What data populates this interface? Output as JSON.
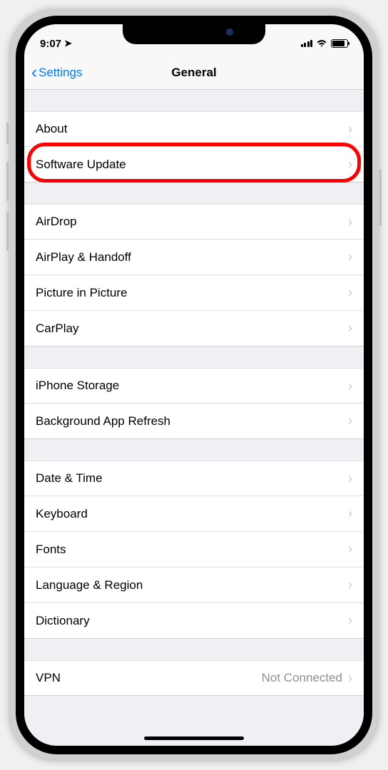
{
  "status": {
    "time": "9:07",
    "location_glyph": "➤"
  },
  "nav": {
    "back_label": "Settings",
    "title": "General"
  },
  "sections": [
    {
      "items": [
        {
          "label": "About"
        },
        {
          "label": "Software Update",
          "highlighted": true
        }
      ]
    },
    {
      "items": [
        {
          "label": "AirDrop"
        },
        {
          "label": "AirPlay & Handoff"
        },
        {
          "label": "Picture in Picture"
        },
        {
          "label": "CarPlay"
        }
      ]
    },
    {
      "items": [
        {
          "label": "iPhone Storage"
        },
        {
          "label": "Background App Refresh"
        }
      ]
    },
    {
      "items": [
        {
          "label": "Date & Time"
        },
        {
          "label": "Keyboard"
        },
        {
          "label": "Fonts"
        },
        {
          "label": "Language & Region"
        },
        {
          "label": "Dictionary"
        }
      ]
    },
    {
      "items": [
        {
          "label": "VPN",
          "value": "Not Connected"
        }
      ]
    }
  ]
}
